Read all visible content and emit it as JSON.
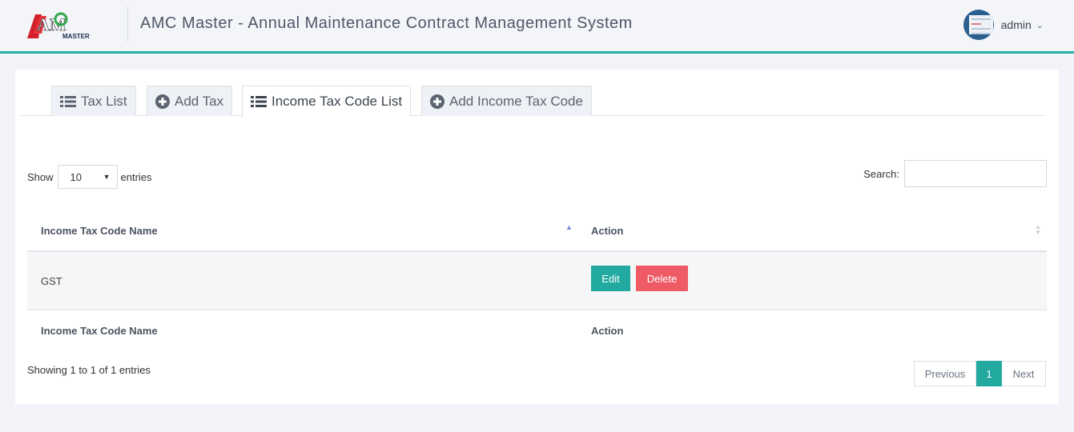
{
  "header": {
    "logo_text": "MASTER",
    "title": "AMC Master - Annual Maintenance Contract Management System",
    "username": "admin",
    "accent": "#26b1a6"
  },
  "tabs": [
    {
      "label": "Tax List",
      "icon": "list-icon"
    },
    {
      "label": "Add Tax",
      "icon": "plus-circle-icon"
    },
    {
      "label": "Income Tax Code List",
      "icon": "list-icon",
      "active": true
    },
    {
      "label": "Add Income Tax Code",
      "icon": "plus-circle-icon"
    }
  ],
  "table_controls": {
    "show_label": "Show",
    "page_size": "10",
    "entries_label": "entries",
    "search_label": "Search:",
    "search_value": ""
  },
  "table": {
    "columns": [
      "Income Tax Code Name",
      "Action"
    ],
    "rows": [
      {
        "name": "GST",
        "edit_label": "Edit",
        "delete_label": "Delete"
      }
    ]
  },
  "footer": {
    "info": "Showing 1 to 1 of 1 entries",
    "previous": "Previous",
    "page": "1",
    "next": "Next"
  },
  "colors": {
    "primary": "#22aaa0",
    "danger": "#ef5b65"
  }
}
